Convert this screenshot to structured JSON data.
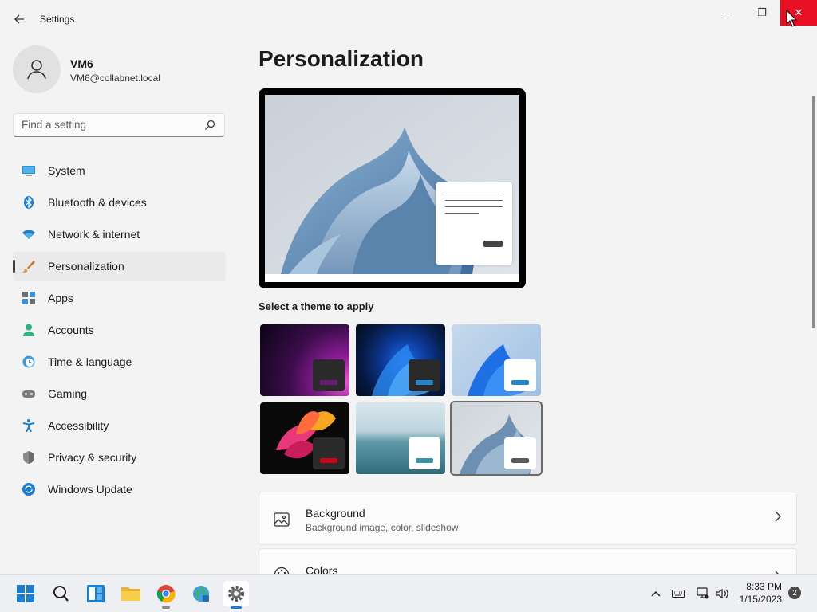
{
  "window": {
    "title": "Settings",
    "controls": {
      "minimize": "–",
      "maximize": "❐",
      "close": "✕"
    }
  },
  "account": {
    "name": "VM6",
    "email": "VM6@collabnet.local"
  },
  "search": {
    "placeholder": "Find a setting"
  },
  "sidebar": {
    "items": [
      {
        "label": "System",
        "icon": "monitor-icon",
        "active": false
      },
      {
        "label": "Bluetooth & devices",
        "icon": "bluetooth-icon",
        "active": false
      },
      {
        "label": "Network & internet",
        "icon": "wifi-icon",
        "active": false
      },
      {
        "label": "Personalization",
        "icon": "brush-icon",
        "active": true
      },
      {
        "label": "Apps",
        "icon": "apps-icon",
        "active": false
      },
      {
        "label": "Accounts",
        "icon": "person-icon",
        "active": false
      },
      {
        "label": "Time & language",
        "icon": "globe-clock-icon",
        "active": false
      },
      {
        "label": "Gaming",
        "icon": "gamepad-icon",
        "active": false
      },
      {
        "label": "Accessibility",
        "icon": "accessibility-icon",
        "active": false
      },
      {
        "label": "Privacy & security",
        "icon": "shield-icon",
        "active": false
      },
      {
        "label": "Windows Update",
        "icon": "update-icon",
        "active": false
      }
    ]
  },
  "main": {
    "title": "Personalization",
    "theme_caption": "Select a theme to apply",
    "themes": [
      {
        "name": "glow",
        "accent": "#6b1a7a",
        "selected": false
      },
      {
        "name": "windows-dark",
        "accent": "#1c86d1",
        "selected": false
      },
      {
        "name": "windows-light",
        "accent": "#1c86d1",
        "selected": false
      },
      {
        "name": "captured-motion",
        "accent": "#d0021b",
        "selected": false
      },
      {
        "name": "sunrise",
        "accent": "#3b93a8",
        "selected": false
      },
      {
        "name": "flow",
        "accent": "#5a5a5a",
        "selected": true
      }
    ],
    "cards": [
      {
        "title": "Background",
        "subtitle": "Background image, color, slideshow",
        "icon": "image-icon"
      },
      {
        "title": "Colors",
        "subtitle": "",
        "icon": "palette-icon"
      }
    ]
  },
  "taskbar": {
    "apps": [
      "start-icon",
      "search-icon",
      "widgets-icon",
      "file-explorer-icon",
      "chrome-icon",
      "network-globe-icon",
      "settings-icon"
    ],
    "time": "8:33 PM",
    "date": "1/15/2023",
    "notifications": "2"
  }
}
